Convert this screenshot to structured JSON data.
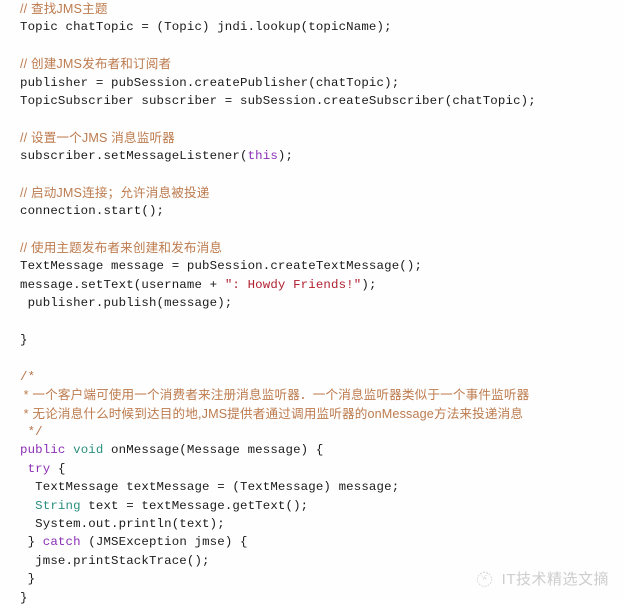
{
  "document": {
    "type": "code-snippet",
    "language": "Java",
    "background_color": "#fefefe",
    "colors": {
      "comment": "#b5744a",
      "keyword": "#8b2fb5",
      "type": "#2a8f7e",
      "string": "#b02030",
      "plain": "#1a1a1a"
    }
  },
  "code": {
    "lines": [
      {
        "id": "l1",
        "blank": false,
        "tokens": [
          {
            "t": "// 查找JMS主题",
            "c": "comment"
          }
        ]
      },
      {
        "id": "l2",
        "blank": false,
        "tokens": [
          {
            "t": "Topic chatTopic = (Topic) jndi.lookup(topicName);",
            "c": "plain"
          }
        ]
      },
      {
        "id": "l3",
        "blank": true,
        "tokens": []
      },
      {
        "id": "l4",
        "blank": false,
        "tokens": [
          {
            "t": "// 创建JMS发布者和订阅者",
            "c": "comment"
          }
        ]
      },
      {
        "id": "l5",
        "blank": false,
        "tokens": [
          {
            "t": "publisher = pubSession.createPublisher(chatTopic);",
            "c": "plain"
          }
        ]
      },
      {
        "id": "l6",
        "blank": false,
        "tokens": [
          {
            "t": "TopicSubscriber subscriber = subSession.createSubscriber(chatTopic);",
            "c": "plain"
          }
        ]
      },
      {
        "id": "l7",
        "blank": true,
        "tokens": []
      },
      {
        "id": "l8",
        "blank": false,
        "tokens": [
          {
            "t": "// 设置一个JMS 消息监听器",
            "c": "comment"
          }
        ]
      },
      {
        "id": "l9",
        "blank": false,
        "tokens": [
          {
            "t": "subscriber.setMessageListener(",
            "c": "plain"
          },
          {
            "t": "this",
            "c": "keyword"
          },
          {
            "t": ");",
            "c": "plain"
          }
        ]
      },
      {
        "id": "l10",
        "blank": true,
        "tokens": []
      },
      {
        "id": "l11",
        "blank": false,
        "tokens": [
          {
            "t": "// 启动JMS连接；允许消息被投递",
            "c": "comment"
          }
        ]
      },
      {
        "id": "l12",
        "blank": false,
        "tokens": [
          {
            "t": "connection.start();",
            "c": "plain"
          }
        ]
      },
      {
        "id": "l13",
        "blank": true,
        "tokens": []
      },
      {
        "id": "l14",
        "blank": false,
        "tokens": [
          {
            "t": "// 使用主题发布者来创建和发布消息",
            "c": "comment"
          }
        ]
      },
      {
        "id": "l15",
        "blank": false,
        "tokens": [
          {
            "t": "TextMessage message = pubSession.createTextMessage();",
            "c": "plain"
          }
        ]
      },
      {
        "id": "l16",
        "blank": false,
        "tokens": [
          {
            "t": "message.setText(username + ",
            "c": "plain"
          },
          {
            "t": "\": Howdy Friends!\"",
            "c": "string"
          },
          {
            "t": ");",
            "c": "plain"
          }
        ]
      },
      {
        "id": "l17",
        "blank": false,
        "tokens": [
          {
            "t": " publisher.publish(message);",
            "c": "plain"
          }
        ]
      },
      {
        "id": "l18",
        "blank": true,
        "tokens": []
      },
      {
        "id": "l19",
        "blank": false,
        "tokens": [
          {
            "t": "}",
            "c": "plain"
          }
        ]
      },
      {
        "id": "l20",
        "blank": true,
        "tokens": []
      },
      {
        "id": "l21",
        "blank": false,
        "tokens": [
          {
            "t": "/*",
            "c": "comment"
          }
        ]
      },
      {
        "id": "l22",
        "blank": false,
        "tokens": [
          {
            "t": " * 一个客户端可使用一个消费者来注册消息监听器．一个消息监听器类似于一个事件监听器",
            "c": "comment"
          }
        ]
      },
      {
        "id": "l23",
        "blank": false,
        "tokens": [
          {
            "t": " * 无论消息什么时候到达目的地,JMS提供者通过调用监听器的onMessage方法来投递消息",
            "c": "comment"
          }
        ]
      },
      {
        "id": "l24",
        "blank": false,
        "tokens": [
          {
            "t": " */",
            "c": "comment"
          }
        ]
      },
      {
        "id": "l25",
        "blank": false,
        "tokens": [
          {
            "t": "public",
            "c": "keyword"
          },
          {
            "t": " ",
            "c": "plain"
          },
          {
            "t": "void",
            "c": "type"
          },
          {
            "t": " onMessage(Message message) {",
            "c": "plain"
          }
        ]
      },
      {
        "id": "l26",
        "blank": false,
        "tokens": [
          {
            "t": " ",
            "c": "plain"
          },
          {
            "t": "try",
            "c": "keyword"
          },
          {
            "t": " {",
            "c": "plain"
          }
        ]
      },
      {
        "id": "l27",
        "blank": false,
        "tokens": [
          {
            "t": "  TextMessage textMessage = (TextMessage) message;",
            "c": "plain"
          }
        ]
      },
      {
        "id": "l28",
        "blank": false,
        "tokens": [
          {
            "t": "  ",
            "c": "plain"
          },
          {
            "t": "String",
            "c": "type"
          },
          {
            "t": " text = textMessage.getText();",
            "c": "plain"
          }
        ]
      },
      {
        "id": "l29",
        "blank": false,
        "tokens": [
          {
            "t": "  System.out.println(text);",
            "c": "plain"
          }
        ]
      },
      {
        "id": "l30",
        "blank": false,
        "tokens": [
          {
            "t": " } ",
            "c": "plain"
          },
          {
            "t": "catch",
            "c": "keyword"
          },
          {
            "t": " (JMSException jmse) {",
            "c": "plain"
          }
        ]
      },
      {
        "id": "l31",
        "blank": false,
        "tokens": [
          {
            "t": "  jmse.printStackTrace();",
            "c": "plain"
          }
        ]
      },
      {
        "id": "l32",
        "blank": false,
        "tokens": [
          {
            "t": " }",
            "c": "plain"
          }
        ]
      },
      {
        "id": "l33",
        "blank": false,
        "tokens": [
          {
            "t": "}",
            "c": "plain"
          }
        ]
      }
    ]
  },
  "watermark": {
    "text": "IT技术精选文摘",
    "logo_icon": "dotted-circle-logo-icon",
    "color": "#8a8a8a"
  }
}
